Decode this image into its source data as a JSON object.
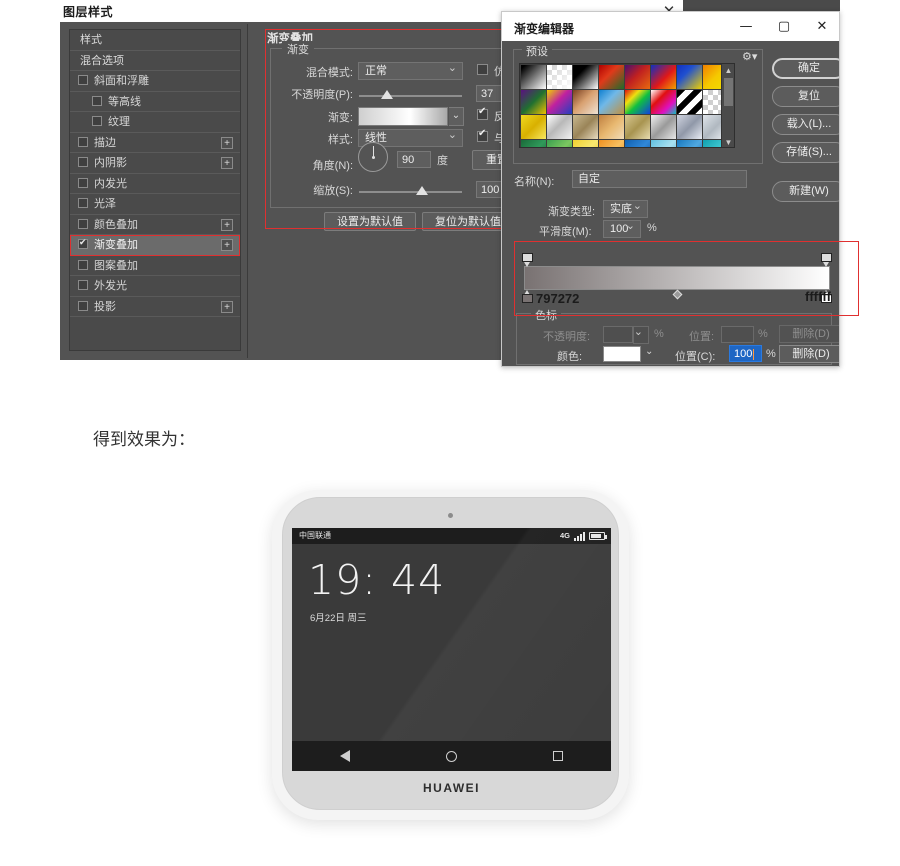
{
  "layer_style": {
    "title": "图层样式",
    "close_icon": "close-icon",
    "styles_list": [
      {
        "label": "样式",
        "type": "head"
      },
      {
        "label": "混合选项",
        "type": "head"
      },
      {
        "label": "斜面和浮雕",
        "checked": false,
        "plus": false,
        "indent": false
      },
      {
        "label": "等高线",
        "checked": false,
        "plus": false,
        "indent": true
      },
      {
        "label": "纹理",
        "checked": false,
        "plus": false,
        "indent": true
      },
      {
        "label": "描边",
        "checked": false,
        "plus": true,
        "indent": false
      },
      {
        "label": "内阴影",
        "checked": false,
        "plus": true,
        "indent": false
      },
      {
        "label": "内发光",
        "checked": false,
        "plus": false,
        "indent": false
      },
      {
        "label": "光泽",
        "checked": false,
        "plus": false,
        "indent": false
      },
      {
        "label": "颜色叠加",
        "checked": false,
        "plus": true,
        "indent": false
      },
      {
        "label": "渐变叠加",
        "checked": true,
        "plus": true,
        "indent": false,
        "selected": true,
        "highlighted": true
      },
      {
        "label": "图案叠加",
        "checked": false,
        "plus": false,
        "indent": false
      },
      {
        "label": "外发光",
        "checked": false,
        "plus": false,
        "indent": false
      },
      {
        "label": "投影",
        "checked": false,
        "plus": true,
        "indent": false
      }
    ],
    "panel_title": "渐变叠加",
    "group_title": "渐变",
    "blend_mode_label": "混合模式:",
    "blend_mode_value": "正常",
    "dither_label": "仿色",
    "dither_checked": false,
    "opacity_label": "不透明度(P):",
    "opacity_value": "37",
    "opacity_unit": "%",
    "gradient_label": "渐变:",
    "reverse_label": "反向(R)",
    "reverse_checked": true,
    "style_label": "样式:",
    "style_value": "线性",
    "align_label": "与图层对齐",
    "align_checked": true,
    "angle_label": "角度(N):",
    "angle_value": "90",
    "angle_unit": "度",
    "reset_align_label": "重置对齐",
    "scale_label": "缩放(S):",
    "scale_value": "100",
    "scale_unit": "%",
    "set_default_label": "设置为默认值",
    "reset_default_label": "复位为默认值"
  },
  "gradient_editor": {
    "title": "渐变编辑器",
    "minimize_icon": "minimize-icon",
    "maximize_icon": "maximize-icon",
    "close_icon": "close-icon",
    "presets_label": "预设",
    "gear_icon": "gear-icon",
    "name_label": "名称(N):",
    "name_value": "自定",
    "buttons": [
      {
        "label": "确定",
        "primary": true
      },
      {
        "label": "复位",
        "primary": false
      },
      {
        "label": "载入(L)...",
        "primary": false
      },
      {
        "label": "存储(S)...",
        "primary": false
      },
      {
        "label": "新建(W)",
        "primary": false
      }
    ],
    "gradient_type_label": "渐变类型:",
    "gradient_type_value": "实底",
    "smoothness_label": "平滑度(M):",
    "smoothness_value": "100",
    "smoothness_unit": "%",
    "stops_group_label": "色标",
    "opacity_label": "不透明度:",
    "opacity_value": "",
    "opacity_unit": "%",
    "position_label": "位置:",
    "position_value": "",
    "position_unit": "%",
    "delete_opacity_label": "删除(D)",
    "color_label": "颜色:",
    "position_c_label": "位置(C):",
    "position_c_value": "100",
    "position_c_unit": "%",
    "delete_color_label": "删除(D)",
    "annotation_left_hex": "797272",
    "annotation_right_hex": "ffffff",
    "gradient_start_color": "#797272",
    "gradient_end_color": "#ffffff",
    "preset_swatches": [
      "linear-gradient(135deg,#000 0%,#000 8%,#ffffff 100%)",
      "linear-gradient(135deg,rgba(255,255,255,0) 0%,#ffffff 100%),repeating-conic-gradient(#cfcfcf 0% 25%,#ffffff 0% 50%) 0 0/10px 10px",
      "linear-gradient(135deg,#000000 0%,#000000 30%,#ffffff 100%)",
      "linear-gradient(135deg,#b00000 0%,#e03a1a 40%,#1f6b2a 100%)",
      "linear-gradient(135deg,#4a1070 0%,#c02020 45%,#e86a10 100%)",
      "linear-gradient(135deg,#1030c0 0%,#e01818 55%,#f0a000 100%)",
      "linear-gradient(135deg,#1030c0 0%,#2050d0 35%,#f0d000 100%)",
      "linear-gradient(135deg,#f08000 0%,#f5c800 50%,#f0e000 100%)",
      "linear-gradient(135deg,#5a1080 0%,#207030 50%,#f0c000 100%)",
      "linear-gradient(135deg,#f0d000 0%,#c020a0 45%,#2040c0 100%)",
      "linear-gradient(135deg,#7a4020 0%,#d8a070 45%,#efe3d4 100%)",
      "linear-gradient(135deg,#1080d0 0%,#70b8e8 40%,#c09040 100%)",
      "linear-gradient(135deg,#e01010 0%,#f0e010 30%,#10c040 55%,#1040e0 100%)",
      "linear-gradient(135deg,#ffffff 0%,#e01010 35%,#e010c0 70%,#10c0c0 100%)",
      "repeating-linear-gradient(135deg,#000 0 6px,#fff 6px 12px)",
      "repeating-conic-gradient(#cfcfcf 0% 25%,#ffffff 0% 50%) 0 0/10px 10px",
      "linear-gradient(135deg,#f0d820 0%,#d8b000 50%,#f8e860 100%)",
      "linear-gradient(135deg,#ffffff 0%,#b8b8b8 45%,#f2f2f2 100%)",
      "linear-gradient(135deg,#c8b890 0%,#9a8458 50%,#e8dcc0 100%)",
      "linear-gradient(135deg,#c08040 0%,#e8b870 50%,#f0dcb8 100%)",
      "linear-gradient(135deg,#d8c890 0%,#a89450 50%,#e8dcb0 100%)",
      "linear-gradient(135deg,#f0f0f0 0%,#9a9a9a 50%,#e8e8e8 100%)",
      "linear-gradient(135deg,#d0d4e0 0%,#9098a8 50%,#e8ecf4 100%)",
      "linear-gradient(135deg,#dfe4ea 0%,#b0b8c0 50%,#f0f4f8 100%)",
      "linear-gradient(135deg,#1a6a3a 0%,#2f9a5a 50%,#186030 100%)",
      "linear-gradient(135deg,#3aa050 0%,#7cc860 50%,#2f8a42 100%)",
      "linear-gradient(135deg,#f0d030 0%,#f8e870 50%,#e8c020 100%)",
      "linear-gradient(135deg,#f09020 0%,#f8c060 50%,#e88010 100%)",
      "linear-gradient(135deg,#1060b0 0%,#3088d8 50%,#0d4f96 100%)",
      "linear-gradient(135deg,#60c0e0 0%,#a8e0f0 50%,#50b0d8 100%)",
      "linear-gradient(135deg,#1878c0 0%,#50a8e0 50%,#1068b0 100%)",
      "linear-gradient(135deg,#10a0b0 0%,#40c8d0 50%,#0c90a0 100%)"
    ]
  },
  "effect_caption": "得到效果为：",
  "phone": {
    "carrier": "中国联通",
    "network": "4G",
    "signal_icon": "signal-bars-icon",
    "battery_icon": "battery-icon",
    "time": "19: 44",
    "date": "6月22日 周三",
    "nav_back_icon": "back-triangle-icon",
    "nav_home_icon": "home-circle-icon",
    "nav_recent_icon": "recents-square-icon",
    "brand": "HUAWEI",
    "camera_icon": "front-camera-icon"
  }
}
